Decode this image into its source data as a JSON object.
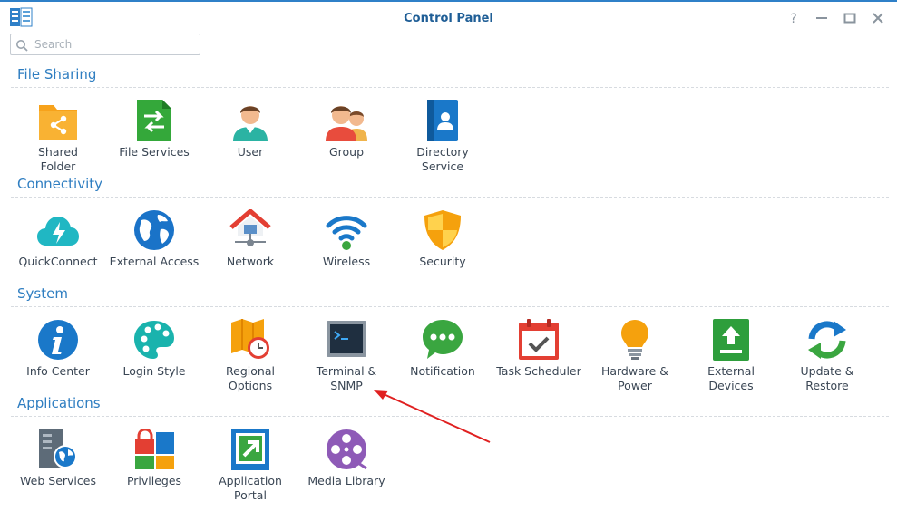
{
  "window": {
    "title": "Control Panel"
  },
  "search": {
    "placeholder": "Search"
  },
  "sections": {
    "file_sharing": {
      "title": "File Sharing",
      "items": [
        "Shared\nFolder",
        "File Services",
        "User",
        "Group",
        "Directory\nService"
      ]
    },
    "connectivity": {
      "title": "Connectivity",
      "items": [
        "QuickConnect",
        "External Access",
        "Network",
        "Wireless",
        "Security"
      ]
    },
    "system": {
      "title": "System",
      "items": [
        "Info Center",
        "Login Style",
        "Regional\nOptions",
        "Terminal &\nSNMP",
        "Notification",
        "Task Scheduler",
        "Hardware &\nPower",
        "External\nDevices",
        "Update &\nRestore"
      ]
    },
    "applications": {
      "title": "Applications",
      "items": [
        "Web Services",
        "Privileges",
        "Application\nPortal",
        "Media Library"
      ]
    }
  },
  "colors": {
    "accent": "#2f7ec1",
    "title": "#1f5e96",
    "annotation_arrow": "#e02020"
  },
  "icons": {
    "window_controls": [
      "help-icon",
      "minimize-icon",
      "maximize-icon",
      "close-icon"
    ]
  }
}
